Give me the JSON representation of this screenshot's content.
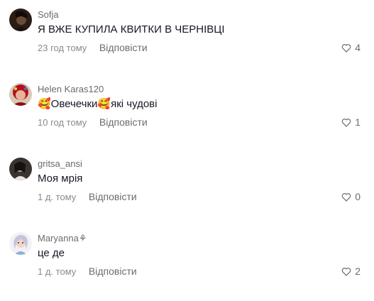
{
  "comments": [
    {
      "username": "Sofja",
      "text": "Я ВЖЕ КУПИЛА КВИТКИ В ЧЕРНІВЦІ",
      "time": "23 год тому",
      "reply_label": "Відповісти",
      "likes": "4",
      "avatar_icon": "user-avatar-dark"
    },
    {
      "username": "Helen Karas120",
      "text": "🥰Овечечки🥰які чудові",
      "time": "10 год тому",
      "reply_label": "Відповісти",
      "likes": "1",
      "avatar_icon": "user-avatar-red-headscarf"
    },
    {
      "username": "gritsa_ansi",
      "text": "Моя мрія",
      "time": "1 д. тому",
      "reply_label": "Відповісти",
      "likes": "0",
      "avatar_icon": "user-avatar-photo"
    },
    {
      "username": "Maryanna⚘",
      "text": "це де",
      "time": "1 д. тому",
      "reply_label": "Відповісти",
      "likes": "2",
      "avatar_icon": "user-avatar-illustration"
    }
  ],
  "colors": {
    "text": "#161823",
    "secondary": "#8a8a8a",
    "background": "#ffffff"
  }
}
